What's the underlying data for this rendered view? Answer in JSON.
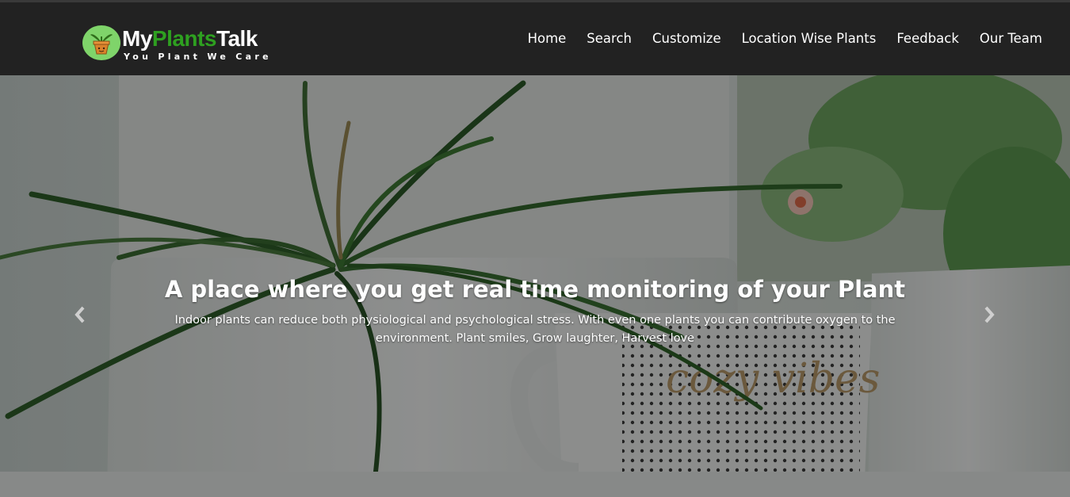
{
  "brand": {
    "name_part1": "My",
    "name_part2": "Plants",
    "name_part3": "Talk",
    "tagline": "You Plant We Care",
    "accent_color": "#2ea020",
    "logo_icon": "potted-plant-icon"
  },
  "nav": {
    "items": [
      {
        "label": "Home"
      },
      {
        "label": "Search"
      },
      {
        "label": "Customize"
      },
      {
        "label": "Location Wise Plants"
      },
      {
        "label": "Feedback"
      },
      {
        "label": "Our Team"
      }
    ]
  },
  "hero": {
    "heading": "A place where you get real time monitoring of your Plant",
    "description": "Indoor plants can reduce both physiological and psychological stress. With even one plants you can contribute oxygen to the environment. Plant smiles, Grow laughter, Harvest love",
    "prev_icon": "chevron-left-icon",
    "next_icon": "chevron-right-icon",
    "background_image": "plants-and-mug-photo",
    "mug_lettering": "cozy vibes"
  }
}
